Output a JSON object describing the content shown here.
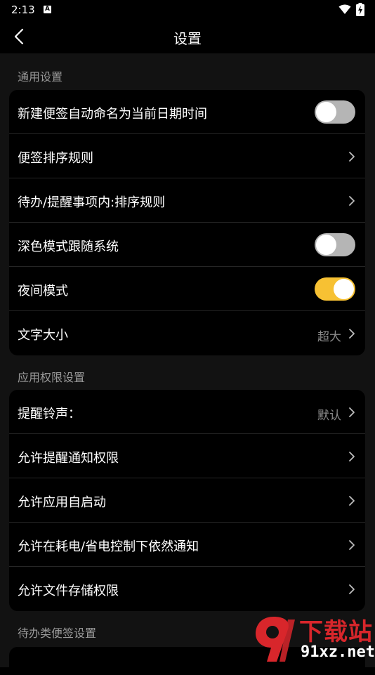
{
  "status_bar": {
    "time": "2:13",
    "a_label": "A"
  },
  "header": {
    "title": "设置"
  },
  "sections": [
    {
      "title": "通用设置",
      "rows": [
        {
          "label": "新建便签自动命名为当前日期时间",
          "type": "toggle",
          "on": false
        },
        {
          "label": "便签排序规则",
          "type": "nav"
        },
        {
          "label": "待办/提醒事项内:排序规则",
          "type": "nav"
        },
        {
          "label": "深色模式跟随系统",
          "type": "toggle",
          "on": false
        },
        {
          "label": "夜间模式",
          "type": "toggle",
          "on": true
        },
        {
          "label": "文字大小",
          "type": "nav",
          "value": "超大"
        }
      ]
    },
    {
      "title": "应用权限设置",
      "rows": [
        {
          "label": "提醒铃声：",
          "type": "nav",
          "value": "默认"
        },
        {
          "label": "允许提醒通知权限",
          "type": "nav"
        },
        {
          "label": "允许应用自启动",
          "type": "nav"
        },
        {
          "label": "允许在耗电/省电控制下依然通知",
          "type": "nav"
        },
        {
          "label": "允许文件存储权限",
          "type": "nav"
        }
      ]
    },
    {
      "title": "待办类便签设置",
      "rows": []
    }
  ],
  "watermark": {
    "logo_text": "下载站",
    "domain": "91xz.net"
  },
  "colors": {
    "toggle_on": "#f7c133",
    "toggle_off": "#b5b5b5",
    "watermark_red": "#d8262b"
  },
  "icons": {
    "back": "back-arrow-icon",
    "chevron": "chevron-right-icon",
    "wifi": "wifi-icon",
    "battery": "battery-charging-icon"
  }
}
